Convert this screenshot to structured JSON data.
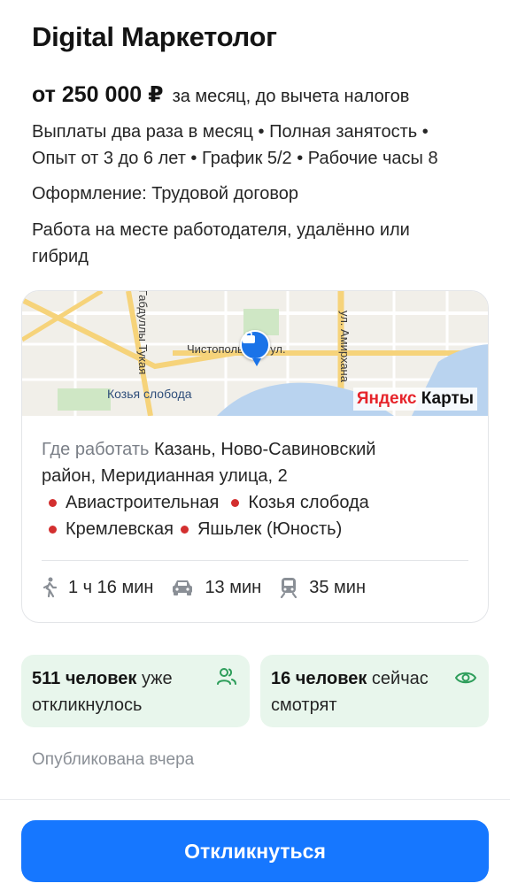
{
  "vacancy": {
    "title": "Digital Маркетолог",
    "salary_amount": "от 250 000 ₽",
    "salary_note": "за месяц, до вычета налогов",
    "conditions_line1": "Выплаты два раза в месяц • Полная занятость •",
    "conditions_line2": "Опыт от 3 до 6 лет • График 5/2 • Рабочие часы 8",
    "employment": "Оформление: Трудовой договор",
    "work_format_line1": "Работа на месте работодателя, удалённо или",
    "work_format_line2": "гибрид"
  },
  "map": {
    "street_1": "Чистопольская ул.",
    "street_2": "ул. Амирхана",
    "street_3": "Габдуллы Тукая",
    "metro_label": "Козья слобода",
    "logo_ya": "Яндекс",
    "logo_rest": " Карты",
    "pin_icon": "briefcase-icon"
  },
  "address": {
    "label": "Где работать",
    "line1_rest": " Казань, Ново-Савиновский",
    "line2": "район, Меридианная улица, 2",
    "metro": [
      "Авиастроительная",
      "Козья слобода",
      "Кремлевская",
      "Яшьлек (Юность)"
    ],
    "metro_color": "#d32f2f"
  },
  "transport": {
    "walk": "1 ч 16 мин",
    "car": "13 мин",
    "public": "35 мин"
  },
  "stats": {
    "responded_count": "511 человек",
    "responded_text": " уже",
    "responded_text2": "откликнулось",
    "viewing_count": "16 человек",
    "viewing_text": " сейчас",
    "viewing_text2": "смотрят",
    "accent": "#2e9e5b"
  },
  "published": "Опубликована вчера",
  "apply_button": "Откликнуться",
  "colors": {
    "primary": "#1677ff",
    "stat_bg": "#e8f6ec"
  }
}
